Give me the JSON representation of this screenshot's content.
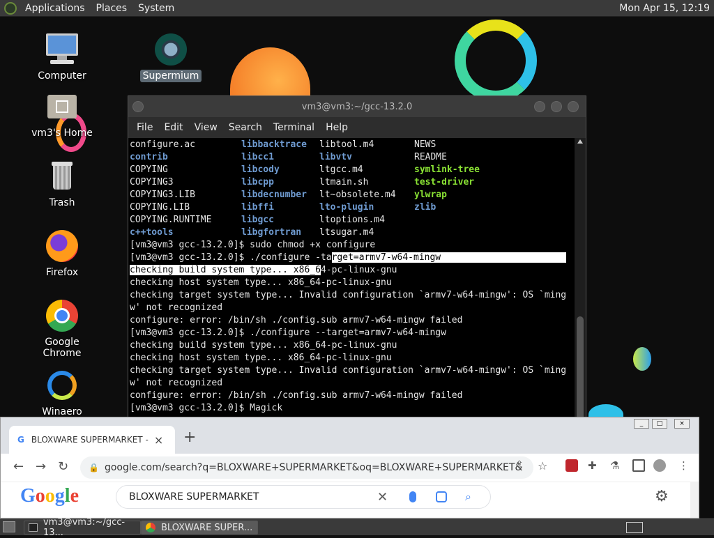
{
  "top_panel": {
    "menus": [
      "Applications",
      "Places",
      "System"
    ],
    "clock": "Mon Apr 15, 12:19"
  },
  "desktop": {
    "icons": [
      {
        "label": "Computer",
        "icon": "computer-icon"
      },
      {
        "label": "Supermium",
        "icon": "supermium-icon"
      },
      {
        "label": "vm3's Home",
        "icon": "home-folder-icon"
      },
      {
        "label": "Trash",
        "icon": "trash-icon"
      },
      {
        "label": "Firefox",
        "icon": "firefox-icon"
      },
      {
        "label": "Google Chrome",
        "icon": "chrome-icon"
      },
      {
        "label": "Winaero Tweaker",
        "icon": "winaero-tweaker-icon"
      }
    ]
  },
  "terminal": {
    "title": "vm3@vm3:~/gcc-13.2.0",
    "menu": [
      "File",
      "Edit",
      "View",
      "Search",
      "Terminal",
      "Help"
    ],
    "listing": [
      [
        {
          "t": "configure.ac",
          "k": ""
        },
        {
          "t": "libbacktrace",
          "k": "dir"
        },
        {
          "t": "libtool.m4",
          "k": ""
        },
        {
          "t": "NEWS",
          "k": ""
        }
      ],
      [
        {
          "t": "contrib",
          "k": "dir"
        },
        {
          "t": "libcc1",
          "k": "dir"
        },
        {
          "t": "libvtv",
          "k": "dir"
        },
        {
          "t": "README",
          "k": ""
        }
      ],
      [
        {
          "t": "COPYING",
          "k": ""
        },
        {
          "t": "libcody",
          "k": "dir"
        },
        {
          "t": "ltgcc.m4",
          "k": ""
        },
        {
          "t": "symlink-tree",
          "k": "exe"
        }
      ],
      [
        {
          "t": "COPYING3",
          "k": ""
        },
        {
          "t": "libcpp",
          "k": "dir"
        },
        {
          "t": "ltmain.sh",
          "k": ""
        },
        {
          "t": "test-driver",
          "k": "exe"
        }
      ],
      [
        {
          "t": "COPYING3.LIB",
          "k": ""
        },
        {
          "t": "libdecnumber",
          "k": "dir"
        },
        {
          "t": "lt~obsolete.m4",
          "k": ""
        },
        {
          "t": "ylwrap",
          "k": "exe"
        }
      ],
      [
        {
          "t": "COPYING.LIB",
          "k": ""
        },
        {
          "t": "libffi",
          "k": "dir"
        },
        {
          "t": "lto-plugin",
          "k": "dir"
        },
        {
          "t": "zlib",
          "k": "dir"
        }
      ],
      [
        {
          "t": "COPYING.RUNTIME",
          "k": ""
        },
        {
          "t": "libgcc",
          "k": "dir"
        },
        {
          "t": "ltoptions.m4",
          "k": ""
        },
        {
          "t": "",
          "k": ""
        }
      ],
      [
        {
          "t": "c++tools",
          "k": "dir"
        },
        {
          "t": "libgfortran",
          "k": "dir"
        },
        {
          "t": "ltsugar.m4",
          "k": ""
        },
        {
          "t": "",
          "k": ""
        }
      ]
    ],
    "lines": [
      "[vm3@vm3 gcc-13.2.0]$ sudo chmod +x configure",
      "[vm3@vm3 gcc-13.2.0]$ ./configure -target=armv7-w64-mingw",
      "checking build system type... x86_64-pc-linux-gnu",
      "checking host system type... x86_64-pc-linux-gnu",
      "checking target system type... Invalid configuration `armv7-w64-mingw': OS `ming",
      "w' not recognized",
      "configure: error: /bin/sh ./config.sub armv7-w64-mingw failed",
      "[vm3@vm3 gcc-13.2.0]$ ./configure --target=armv7-w64-mingw",
      "checking build system type... x86_64-pc-linux-gnu",
      "checking host system type... x86_64-pc-linux-gnu",
      "checking target system type... Invalid configuration `armv7-w64-mingw': OS `ming",
      "w' not recognized",
      "configure: error: /bin/sh ./config.sub armv7-w64-mingw failed",
      "[vm3@vm3 gcc-13.2.0]$ Magick"
    ]
  },
  "chrome": {
    "tab_title": "BLOXWARE SUPERMARKET - Goog",
    "url": "google.com/search?q=BLOXWARE+SUPERMARKET&oq=BLOXWARE+SUPERMARKET&gs_lc...",
    "search_query": "BLOXWARE SUPERMARKET",
    "logo_text": "Google"
  },
  "taskbar": {
    "tasks": [
      "vm3@vm3:~/gcc-13...",
      "BLOXWARE SUPER..."
    ]
  },
  "colors": {
    "accent_folder": "#6f9bd1",
    "accent_exec": "#8ae234"
  }
}
